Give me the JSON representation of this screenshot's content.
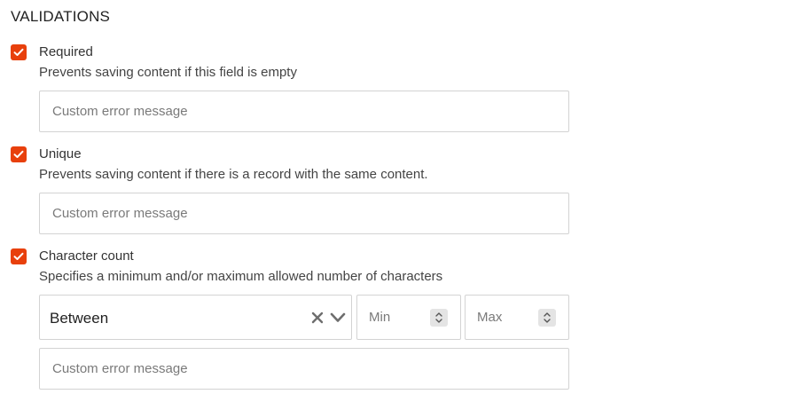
{
  "section": {
    "title": "VALIDATIONS"
  },
  "rules": {
    "required": {
      "label": "Required",
      "description": "Prevents saving content if this field is empty",
      "checked": true,
      "error_placeholder": "Custom error message"
    },
    "unique": {
      "label": "Unique",
      "description": "Prevents saving content if there is a record with the same content.",
      "checked": true,
      "error_placeholder": "Custom error message"
    },
    "character_count": {
      "label": "Character count",
      "description": "Specifies a minimum and/or maximum allowed number of characters",
      "checked": true,
      "mode": "Between",
      "min_placeholder": "Min",
      "max_placeholder": "Max",
      "error_placeholder": "Custom error message"
    }
  },
  "colors": {
    "accent": "#e8400c",
    "border": "#d3d3d3",
    "placeholder": "#7a7a7a"
  },
  "icons": {
    "checkbox": "check-icon",
    "clear": "close-icon",
    "dropdown": "chevron-down-icon",
    "spinner": "spinner-arrows-icon"
  }
}
